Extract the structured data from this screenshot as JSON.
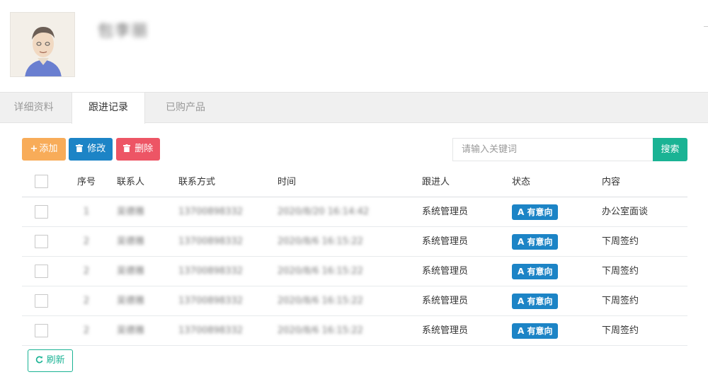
{
  "profile": {
    "name": "包李丽"
  },
  "tabs": [
    {
      "label": "详细资料",
      "active": false
    },
    {
      "label": "跟进记录",
      "active": true
    },
    {
      "label": "已购产品",
      "active": false
    }
  ],
  "toolbar": {
    "add_label": "添加",
    "edit_label": "修改",
    "delete_label": "删除",
    "add_icon": "plus-icon",
    "edit_icon": "trash-icon",
    "delete_icon": "trash-icon",
    "search_placeholder": "请输入关键词",
    "search_label": "搜索"
  },
  "table": {
    "headers": {
      "index": "序号",
      "contact": "联系人",
      "phone": "联系方式",
      "time": "时间",
      "owner": "跟进人",
      "status": "状态",
      "content": "内容"
    },
    "rows": [
      {
        "index": "1",
        "contact": "吴德雅",
        "phone": "13700898332",
        "time": "2020/8/20 16:14:42",
        "owner": "系统管理员",
        "status": "A 有意向",
        "content": "办公室面谈"
      },
      {
        "index": "2",
        "contact": "吴德雅",
        "phone": "13700898332",
        "time": "2020/8/6 16:15:22",
        "owner": "系统管理员",
        "status": "A 有意向",
        "content": "下周签约"
      },
      {
        "index": "2",
        "contact": "吴德雅",
        "phone": "13700898332",
        "time": "2020/8/6 16:15:22",
        "owner": "系统管理员",
        "status": "A 有意向",
        "content": "下周签约"
      },
      {
        "index": "2",
        "contact": "吴德雅",
        "phone": "13700898332",
        "time": "2020/8/6 16:15:22",
        "owner": "系统管理员",
        "status": "A 有意向",
        "content": "下周签约"
      },
      {
        "index": "2",
        "contact": "吴德雅",
        "phone": "13700898332",
        "time": "2020/8/6 16:15:22",
        "owner": "系统管理员",
        "status": "A 有意向",
        "content": "下周签约"
      }
    ]
  },
  "refresh": {
    "label": "刷新",
    "icon": "refresh-icon"
  },
  "colors": {
    "add": "#f8ac59",
    "edit": "#1c84c6",
    "delete": "#ed5565",
    "search": "#1ab394",
    "status_badge": "#1c84c6"
  }
}
